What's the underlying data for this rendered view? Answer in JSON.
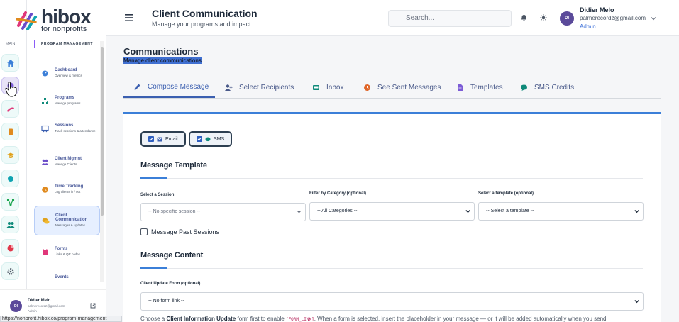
{
  "rail": {
    "label": "MAIN",
    "items": [
      {
        "icon": "home-icon",
        "color": "#3b7fd8"
      },
      {
        "icon": "dashboard-icon",
        "color": "#3b7fd8"
      },
      {
        "icon": "plane-icon",
        "color": "#e0377a"
      },
      {
        "icon": "book-icon",
        "color": "#e08a1e"
      },
      {
        "icon": "graduation-icon",
        "color": "#e0a21e"
      },
      {
        "icon": "circle-icon",
        "color": "#0fa3b1"
      },
      {
        "icon": "branch-icon",
        "color": "#16a34a"
      },
      {
        "icon": "people-icon",
        "color": "#0f8a7a"
      },
      {
        "icon": "pie-chart-icon",
        "color": "#e0374a"
      },
      {
        "icon": "gear-icon",
        "color": "#4b5563"
      }
    ]
  },
  "brand": {
    "name": "hibox",
    "tagline": "for nonprofits"
  },
  "sidebar": {
    "section": "PROGRAM MANAGEMENT",
    "items": [
      {
        "title": "Dashboard",
        "sub": "Overview & metrics"
      },
      {
        "title": "Programs",
        "sub": "Manage programs"
      },
      {
        "title": "Sessions",
        "sub": "Track sessions & attendance"
      },
      {
        "title": "Client Mgmnt",
        "sub": "Manage Clients"
      },
      {
        "title": "Time Tracking",
        "sub": "Log clients in / out"
      },
      {
        "title": "Client Communication",
        "sub": "Messages & updates"
      },
      {
        "title": "Forms",
        "sub": "Links & QR codes"
      },
      {
        "title": "Events",
        "sub": ""
      }
    ],
    "footer": {
      "initials": "DI",
      "name": "Didier Melo",
      "email": "palmerecordz@gmail.com",
      "role": "Admin"
    }
  },
  "statusbar": {
    "url": "https://nonprofit.hibox.co/program-management"
  },
  "header": {
    "title": "Client Communication",
    "subtitle": "Manage your programs and impact",
    "search_placeholder": "Search...",
    "user": {
      "initials": "DI",
      "name": "Didier Melo",
      "email": "palmerecordz@gmail.com",
      "role": "Admin"
    }
  },
  "page": {
    "title": "Communications",
    "subtitle": "Manage client communications",
    "tabs": [
      {
        "label": "Compose Message",
        "icon": "pencil-icon"
      },
      {
        "label": "Select Recipients",
        "icon": "user-plus-icon"
      },
      {
        "label": "Inbox",
        "icon": "inbox-icon"
      },
      {
        "label": "See Sent Messages",
        "icon": "history-icon"
      },
      {
        "label": "Templates",
        "icon": "file-icon"
      },
      {
        "label": "SMS Credits",
        "icon": "chat-icon"
      }
    ]
  },
  "compose": {
    "channels": [
      {
        "label": "Email",
        "checked": true
      },
      {
        "label": "SMS",
        "checked": true
      }
    ],
    "template_section": "Message Template",
    "session_label": "Select a Session",
    "session_value": "-- No specific session --",
    "category_label": "Filter by Category (optional)",
    "category_value": "-- All Categories --",
    "template_label": "Select a template (optional)",
    "template_value": "-- Select a template --",
    "past_sessions": "Message Past Sessions",
    "content_section": "Message Content",
    "form_label": "Client Update Form (optional)",
    "form_value": "-- No form link --",
    "helper_pre": "Choose a ",
    "helper_bold": "Client Information Update",
    "helper_mid": " form first to enable ",
    "helper_code": "[FORM_LINK]",
    "helper_post": ". When a form is selected, insert the placeholder in your message — or it will be added automatically when you send."
  }
}
